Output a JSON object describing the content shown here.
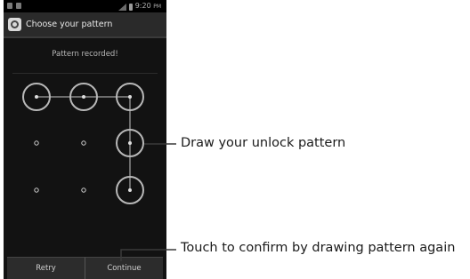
{
  "status_bar": {
    "time": "9:20",
    "time_suffix": "PM"
  },
  "header": {
    "title": "Choose your pattern"
  },
  "main": {
    "message": "Pattern recorded!"
  },
  "pattern": {
    "selected_nodes": [
      1,
      2,
      3,
      6,
      9
    ]
  },
  "buttons": {
    "retry_label": "Retry",
    "continue_label": "Continue"
  },
  "annotations": {
    "draw_label": "Draw your unlock pattern",
    "confirm_label": "Touch to confirm by drawing pattern again"
  }
}
